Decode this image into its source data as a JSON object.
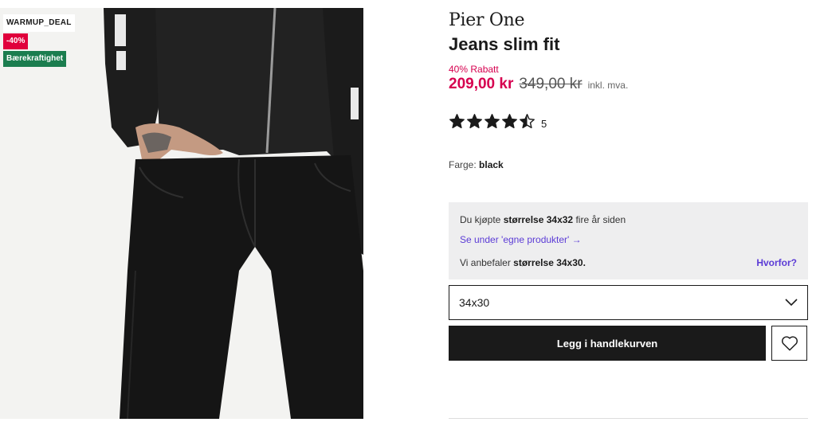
{
  "image": {
    "badges": {
      "deal": "WARMUP_DEAL",
      "discount": "-40%",
      "sustainability": "Bærekraftighet"
    }
  },
  "product": {
    "brand": "Pier One",
    "name": "Jeans slim fit",
    "discount_label": "40% Rabatt",
    "price": "209,00 kr",
    "old_price": "349,00 kr",
    "vat_note": "inkl. mva.",
    "rating": {
      "value": 4.5,
      "max": 5,
      "count": "5"
    },
    "color": {
      "label": "Farge:",
      "value": "black"
    }
  },
  "recommendation": {
    "purchased_prefix": "Du kjøpte",
    "purchased_size": "størrelse 34x32",
    "purchased_suffix": "fire år siden",
    "link": "Se under 'egne produkter' →",
    "recommend_prefix": "Vi anbefaler",
    "recommend_size": "størrelse 34x30.",
    "why": "Hvorfor?"
  },
  "size_select": {
    "value": "34x30"
  },
  "actions": {
    "add_to_cart": "Legg i handlekurven"
  },
  "icons": {
    "rating": "star-icon",
    "select": "chevron-down-icon",
    "wishlist": "heart-icon"
  },
  "colors": {
    "price": "#d6004f",
    "discount_badge": "#e0003c",
    "sustainability_badge": "#1b7d4f",
    "link": "#5b3bd6",
    "button": "#1a1a1a"
  }
}
